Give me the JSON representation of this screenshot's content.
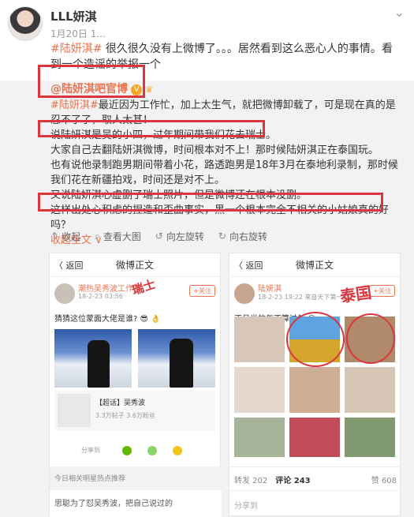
{
  "post": {
    "username": "LLL妍淇",
    "date": "1月20日 1...",
    "hashtag": "#陆妍淇#",
    "text": " 很久很久没有上微博了。。。居然看到这么恶心人的事情。看到一个造谣的举报一个"
  },
  "repost": {
    "author": "@陆妍淇吧官博",
    "hashtag": "#陆妍淇#",
    "lines": [
      "最近因为工作忙，加上太生气，就把微博卸载了，可是现在真的是忍不了了，取人太甚！",
      "说陆妍淇是吴的小四，过年期间带我们花去瑞士。",
      "大家自己去翻陆妍淇微博，时间根本对不上！那时候陆妍淇正在泰国玩。",
      "也有说他录制跑男期间带着小花，路透跑男是18年3月在泰地利录制，那时候我们花在新疆拍戏，时间还是对不上。",
      "又说陆妍淇心虚删了瑞士照片，但是微博还在根本没删。",
      "这样出处心积虑的捏造和歪曲事实，黑一个根本完全不相关的小姑娘真的好吗？"
    ],
    "collapse": "收起全文 ∨"
  },
  "actions": [
    {
      "icon": "collapse-icon",
      "glyph": "↑",
      "label": "收起"
    },
    {
      "icon": "zoom-icon",
      "glyph": "⌕",
      "label": "查看大图"
    },
    {
      "icon": "rotate-left-icon",
      "glyph": "↺",
      "label": "向左旋转"
    },
    {
      "icon": "rotate-right-icon",
      "glyph": "↻",
      "label": "向右旋转"
    }
  ],
  "left_shot": {
    "back": "〈 返回",
    "title": "微博正文",
    "name": "潮热吴秀波工作室",
    "sub": "18-2-23 03:56",
    "follow": "+关注",
    "text": "猜猜这位蒙面大佬是谁? 😎 👌",
    "card_title": "【超话】吴秀波",
    "card_sub": "3.3万帖子 3.6万粉丝",
    "share": "分享到",
    "strip": "今日相关明星热点推荐",
    "bottom": "思聪为了怼吴秀波，把自己说过的",
    "annotation": "瑞士"
  },
  "right_shot": {
    "back": "〈 返回",
    "title": "微博正文",
    "name": "陆妍淇",
    "sub": "18-2-23 19:22 来自天下第一美",
    "follow": "+关注",
    "text": "不月半的年不算过年 😊",
    "share": "分享到",
    "tab_repost": "转发 202",
    "tab_comment": "评论 243",
    "tab_like": "赞 608",
    "annotation": "泰国"
  },
  "colors": {
    "accent": "#eb7350",
    "highlight": "#d9363e"
  }
}
